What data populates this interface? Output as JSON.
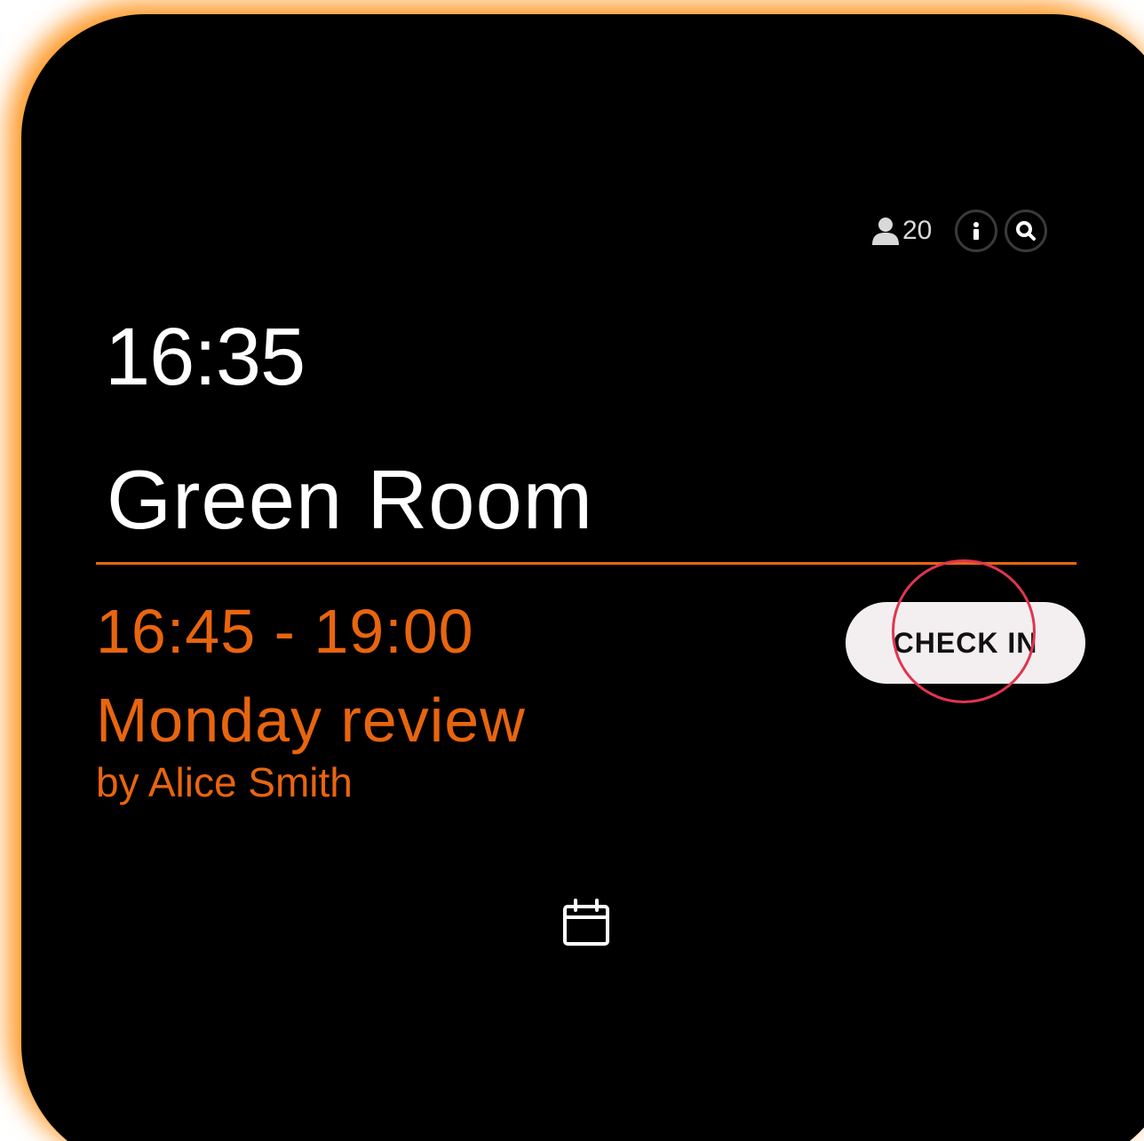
{
  "status": {
    "capacity_icon": "person-icon",
    "capacity": "20",
    "info_icon": "info-icon",
    "search_icon": "search-icon"
  },
  "clock": "16:35",
  "room_name": "Green Room",
  "meeting": {
    "time_range": "16:45 - 19:00",
    "title": "Monday review",
    "organizer": "by Alice Smith"
  },
  "check_in_label": "CHECK IN",
  "bottom_icon": "calendar-icon",
  "colors": {
    "accent": "#e8650f",
    "background": "#000000",
    "border_glow": "#ff9a2a",
    "highlight_ring": "#e0354f",
    "button_bg": "#f3eef0"
  }
}
